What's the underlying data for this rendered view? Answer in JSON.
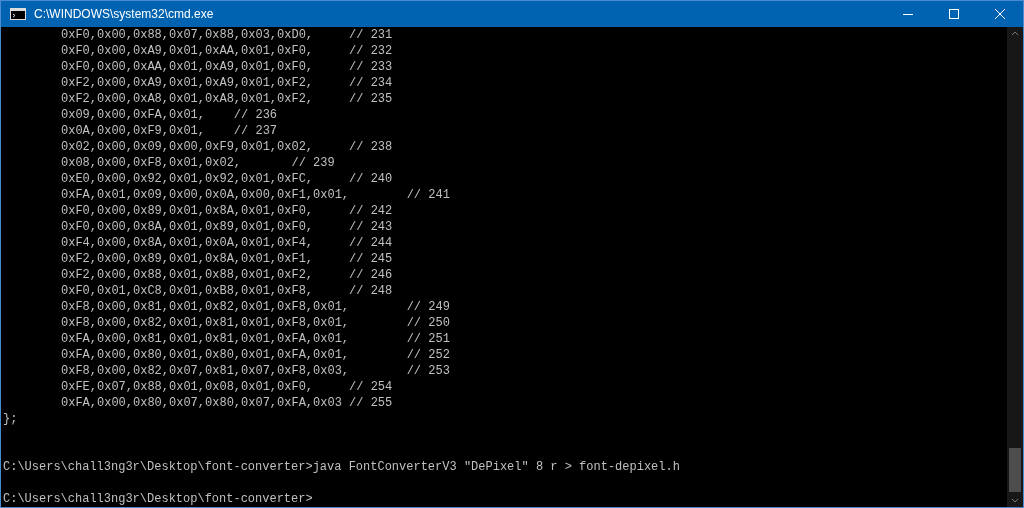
{
  "window": {
    "title": "C:\\WINDOWS\\system32\\cmd.exe"
  },
  "console_lines": [
    {
      "kind": "indented",
      "text": "0xF0,0x00,0x88,0x07,0x88,0x03,0xD0,     // 231"
    },
    {
      "kind": "indented",
      "text": "0xF0,0x00,0xA9,0x01,0xAA,0x01,0xF0,     // 232"
    },
    {
      "kind": "indented",
      "text": "0xF0,0x00,0xAA,0x01,0xA9,0x01,0xF0,     // 233"
    },
    {
      "kind": "indented",
      "text": "0xF2,0x00,0xA9,0x01,0xA9,0x01,0xF2,     // 234"
    },
    {
      "kind": "indented",
      "text": "0xF2,0x00,0xA8,0x01,0xA8,0x01,0xF2,     // 235"
    },
    {
      "kind": "indented",
      "text": "0x09,0x00,0xFA,0x01,    // 236"
    },
    {
      "kind": "indented",
      "text": "0x0A,0x00,0xF9,0x01,    // 237"
    },
    {
      "kind": "indented",
      "text": "0x02,0x00,0x09,0x00,0xF9,0x01,0x02,     // 238"
    },
    {
      "kind": "indented",
      "text": "0x08,0x00,0xF8,0x01,0x02,       // 239"
    },
    {
      "kind": "indented",
      "text": "0xE0,0x00,0x92,0x01,0x92,0x01,0xFC,     // 240"
    },
    {
      "kind": "indented",
      "text": "0xFA,0x01,0x09,0x00,0x0A,0x00,0xF1,0x01,        // 241"
    },
    {
      "kind": "indented",
      "text": "0xF0,0x00,0x89,0x01,0x8A,0x01,0xF0,     // 242"
    },
    {
      "kind": "indented",
      "text": "0xF0,0x00,0x8A,0x01,0x89,0x01,0xF0,     // 243"
    },
    {
      "kind": "indented",
      "text": "0xF4,0x00,0x8A,0x01,0x0A,0x01,0xF4,     // 244"
    },
    {
      "kind": "indented",
      "text": "0xF2,0x00,0x89,0x01,0x8A,0x01,0xF1,     // 245"
    },
    {
      "kind": "indented",
      "text": "0xF2,0x00,0x88,0x01,0x88,0x01,0xF2,     // 246"
    },
    {
      "kind": "indented",
      "text": "0xF0,0x01,0xC8,0x01,0xB8,0x01,0xF8,     // 248"
    },
    {
      "kind": "indented",
      "text": "0xF8,0x00,0x81,0x01,0x82,0x01,0xF8,0x01,        // 249"
    },
    {
      "kind": "indented",
      "text": "0xF8,0x00,0x82,0x01,0x81,0x01,0xF8,0x01,        // 250"
    },
    {
      "kind": "indented",
      "text": "0xFA,0x00,0x81,0x01,0x81,0x01,0xFA,0x01,        // 251"
    },
    {
      "kind": "indented",
      "text": "0xFA,0x00,0x80,0x01,0x80,0x01,0xFA,0x01,        // 252"
    },
    {
      "kind": "indented",
      "text": "0xF8,0x00,0x82,0x07,0x81,0x07,0xF8,0x03,        // 253"
    },
    {
      "kind": "indented",
      "text": "0xFE,0x07,0x88,0x01,0x08,0x01,0xF0,     // 254"
    },
    {
      "kind": "indented",
      "text": "0xFA,0x00,0x80,0x07,0x80,0x07,0xFA,0x03 // 255"
    },
    {
      "kind": "plain",
      "text": "};"
    },
    {
      "kind": "blank"
    },
    {
      "kind": "blank"
    },
    {
      "kind": "plain",
      "text": "C:\\Users\\chall3ng3r\\Desktop\\font-converter>java FontConverterV3 \"DePixel\" 8 r > font-depixel.h"
    },
    {
      "kind": "blank"
    },
    {
      "kind": "plain",
      "text": "C:\\Users\\chall3ng3r\\Desktop\\font-converter>"
    }
  ]
}
